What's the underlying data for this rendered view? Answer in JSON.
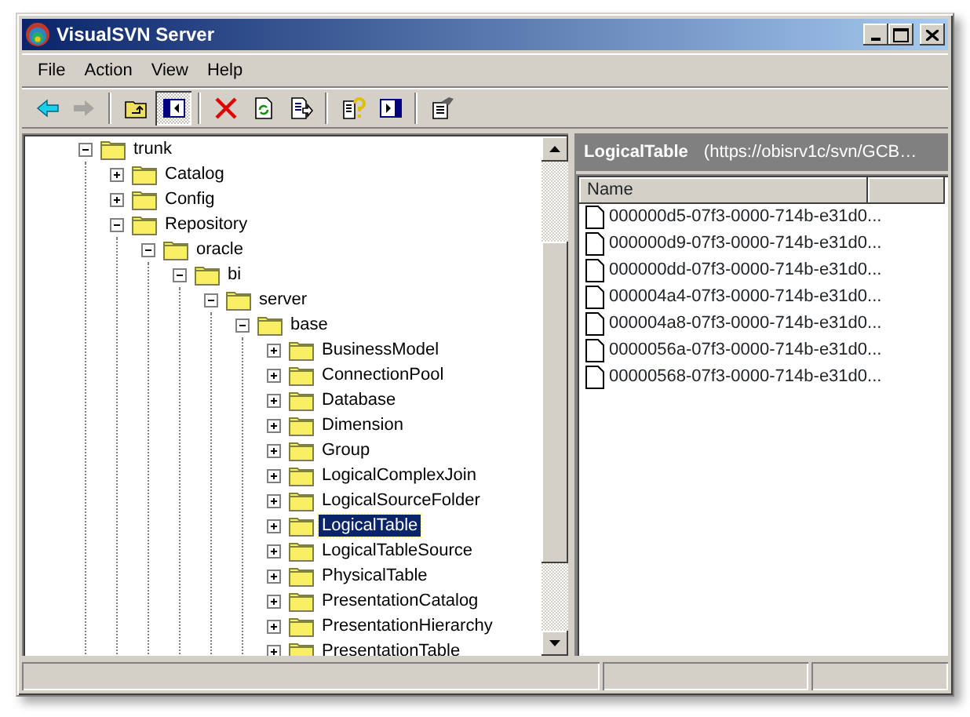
{
  "window": {
    "title": "VisualSVN Server"
  },
  "menu": [
    {
      "label": "File"
    },
    {
      "label": "Action"
    },
    {
      "label": "View"
    },
    {
      "label": "Help"
    }
  ],
  "toolbar": [
    {
      "kind": "back",
      "disabled": false,
      "pressed": false
    },
    {
      "kind": "forward",
      "disabled": true,
      "pressed": false
    },
    {
      "kind": "separator"
    },
    {
      "kind": "up",
      "disabled": false,
      "pressed": false
    },
    {
      "kind": "tree",
      "disabled": false,
      "pressed": true
    },
    {
      "kind": "separator"
    },
    {
      "kind": "delete",
      "disabled": false,
      "pressed": false
    },
    {
      "kind": "refresh",
      "disabled": false,
      "pressed": false
    },
    {
      "kind": "export",
      "disabled": false,
      "pressed": false
    },
    {
      "kind": "separator"
    },
    {
      "kind": "help",
      "disabled": false,
      "pressed": false
    },
    {
      "kind": "pane",
      "disabled": false,
      "pressed": false
    },
    {
      "kind": "separator"
    },
    {
      "kind": "properties",
      "disabled": false,
      "pressed": false
    }
  ],
  "tree": [
    {
      "label": "trunk",
      "expanded": true,
      "selected": false,
      "children": [
        {
          "label": "Catalog",
          "expanded": false,
          "selected": false
        },
        {
          "label": "Config",
          "expanded": false,
          "selected": false
        },
        {
          "label": "Repository",
          "expanded": true,
          "selected": false,
          "children": [
            {
              "label": "oracle",
              "expanded": true,
              "selected": false,
              "children": [
                {
                  "label": "bi",
                  "expanded": true,
                  "selected": false,
                  "children": [
                    {
                      "label": "server",
                      "expanded": true,
                      "selected": false,
                      "children": [
                        {
                          "label": "base",
                          "expanded": true,
                          "selected": false,
                          "children": [
                            {
                              "label": "BusinessModel",
                              "expanded": false,
                              "selected": false
                            },
                            {
                              "label": "ConnectionPool",
                              "expanded": false,
                              "selected": false
                            },
                            {
                              "label": "Database",
                              "expanded": false,
                              "selected": false
                            },
                            {
                              "label": "Dimension",
                              "expanded": false,
                              "selected": false
                            },
                            {
                              "label": "Group",
                              "expanded": false,
                              "selected": false
                            },
                            {
                              "label": "LogicalComplexJoin",
                              "expanded": false,
                              "selected": false
                            },
                            {
                              "label": "LogicalSourceFolder",
                              "expanded": false,
                              "selected": false
                            },
                            {
                              "label": "LogicalTable",
                              "expanded": false,
                              "selected": true
                            },
                            {
                              "label": "LogicalTableSource",
                              "expanded": false,
                              "selected": false
                            },
                            {
                              "label": "PhysicalTable",
                              "expanded": false,
                              "selected": false
                            },
                            {
                              "label": "PresentationCatalog",
                              "expanded": false,
                              "selected": false
                            },
                            {
                              "label": "PresentationHierarchy",
                              "expanded": false,
                              "selected": false
                            },
                            {
                              "label": "PresentationTable",
                              "expanded": false,
                              "selected": false
                            }
                          ]
                        }
                      ]
                    }
                  ]
                }
              ]
            }
          ]
        }
      ]
    }
  ],
  "details": {
    "title": "LogicalTable",
    "path": "(https://obisrv1c/svn/GCB…",
    "columns": [
      "Name"
    ],
    "items": [
      "000000d5-07f3-0000-714b-e31d0...",
      "000000d9-07f3-0000-714b-e31d0...",
      "000000dd-07f3-0000-714b-e31d0...",
      "000004a4-07f3-0000-714b-e31d0...",
      "000004a8-07f3-0000-714b-e31d0...",
      "0000056a-07f3-0000-714b-e31d0...",
      "00000568-07f3-0000-714b-e31d0..."
    ]
  }
}
